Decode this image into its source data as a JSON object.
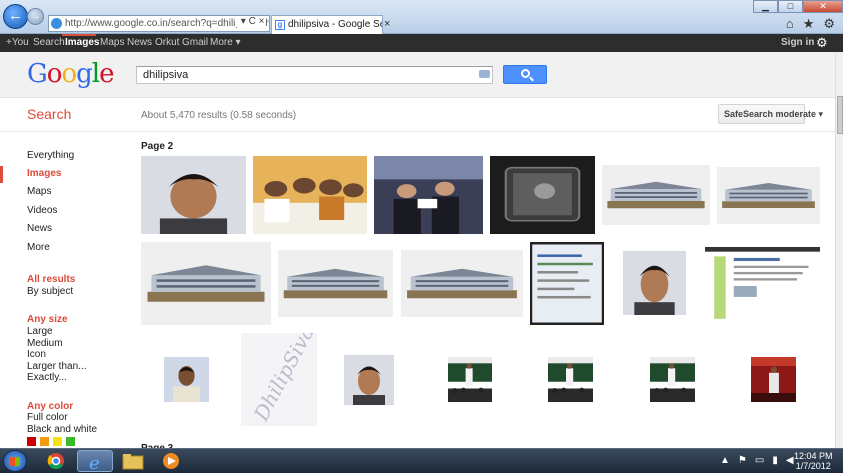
{
  "browser": {
    "address_url": "http://www.google.co.in/search?q=dhilipsiva&hl=",
    "address_tools": " ▾ C ×",
    "tab_title": "dhilipsiva - Google Search",
    "tab_close": "×",
    "window_buttons": {
      "minimize": "▁",
      "maximize": "□",
      "close": "✕"
    },
    "tool_icons": {
      "home": "⌂",
      "favorites": "★",
      "tools": "⚙"
    }
  },
  "gbar": {
    "items": [
      "+You",
      "Search",
      "Images",
      "Maps",
      "News",
      "Orkut",
      "Gmail",
      "More ▾"
    ],
    "active": "Images",
    "sign_in": "Sign in",
    "gear": "⚙"
  },
  "search": {
    "logo": [
      "G",
      "o",
      "o",
      "g",
      "l",
      "e"
    ],
    "query": "dhilipsiva",
    "title": "Search",
    "result_stats": "About 5,470 results (0.58 seconds)",
    "safesearch": "SafeSearch moderate ▾"
  },
  "sidebar": {
    "types": [
      "Everything",
      "Images",
      "Maps",
      "Videos",
      "News",
      "More"
    ],
    "selected": "Images",
    "results_filters": [
      "All results",
      "By subject"
    ],
    "size_header": "Any size",
    "sizes": [
      "Large",
      "Medium",
      "Icon",
      "Larger than...",
      "Exactly..."
    ],
    "color_header": "Any color",
    "colors": [
      "Full color",
      "Black and white"
    ],
    "swatch_colors": [
      "#cc0000",
      "#f39c12",
      "#f5e216",
      "#3aba2a"
    ]
  },
  "results": {
    "page_label": "Page 2",
    "next_page_label": "Page 3",
    "thumbnails": [
      {
        "kind": "portrait-face"
      },
      {
        "kind": "group-photo"
      },
      {
        "kind": "event-crowd"
      },
      {
        "kind": "tablet-device"
      },
      {
        "kind": "building-model"
      },
      {
        "kind": "building-model"
      },
      {
        "kind": "building-model"
      },
      {
        "kind": "building-model"
      },
      {
        "kind": "building-model"
      },
      {
        "kind": "screen-text"
      },
      {
        "kind": "portrait-face"
      },
      {
        "kind": "webpage"
      },
      {
        "kind": "passport-photo"
      },
      {
        "kind": "signature-text"
      },
      {
        "kind": "portrait-face"
      },
      {
        "kind": "presentation"
      },
      {
        "kind": "presentation"
      },
      {
        "kind": "presentation"
      },
      {
        "kind": "presentation-red"
      }
    ],
    "signature_text": "DhilipSiva"
  },
  "taskbar": {
    "clock_time": "12:04 PM",
    "clock_date": "1/7/2012",
    "apps": [
      "chrome-icon",
      "internet-explorer-icon",
      "folder-icon",
      "media-player-icon"
    ]
  }
}
